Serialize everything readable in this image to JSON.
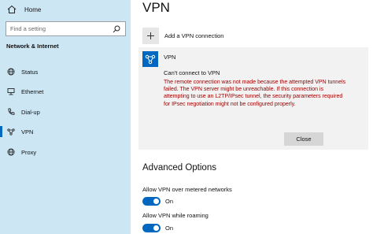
{
  "sidebar": {
    "home_label": "Home",
    "search_placeholder": "Find a setting",
    "section_title": "Network & Internet",
    "items": [
      {
        "label": "Status",
        "icon": "globe-icon"
      },
      {
        "label": "Ethernet",
        "icon": "ethernet-icon"
      },
      {
        "label": "Dial-up",
        "icon": "phone-icon"
      },
      {
        "label": "VPN",
        "icon": "vpn-icon",
        "active": true
      },
      {
        "label": "Proxy",
        "icon": "globe-icon"
      }
    ]
  },
  "main": {
    "title": "VPN",
    "add_label": "Add a VPN connection",
    "connection": {
      "name": "VPN",
      "status": "Can't connect to VPN",
      "error": "The remote connection was not made because the attempted VPN tunnels failed. The VPN server might be unreachable. If this connection is attempting to use an L2TP/IPsec tunnel, the security parameters required for IPsec negotiation might not be configured properly.",
      "close_label": "Close"
    },
    "advanced_title": "Advanced Options",
    "options": [
      {
        "label": "Allow VPN over metered networks",
        "state": "On"
      },
      {
        "label": "Allow VPN while roaming",
        "state": "On"
      }
    ]
  },
  "colors": {
    "accent": "#0067c0",
    "sidebar_bg": "#cde6f4",
    "error_text": "#a00000"
  }
}
